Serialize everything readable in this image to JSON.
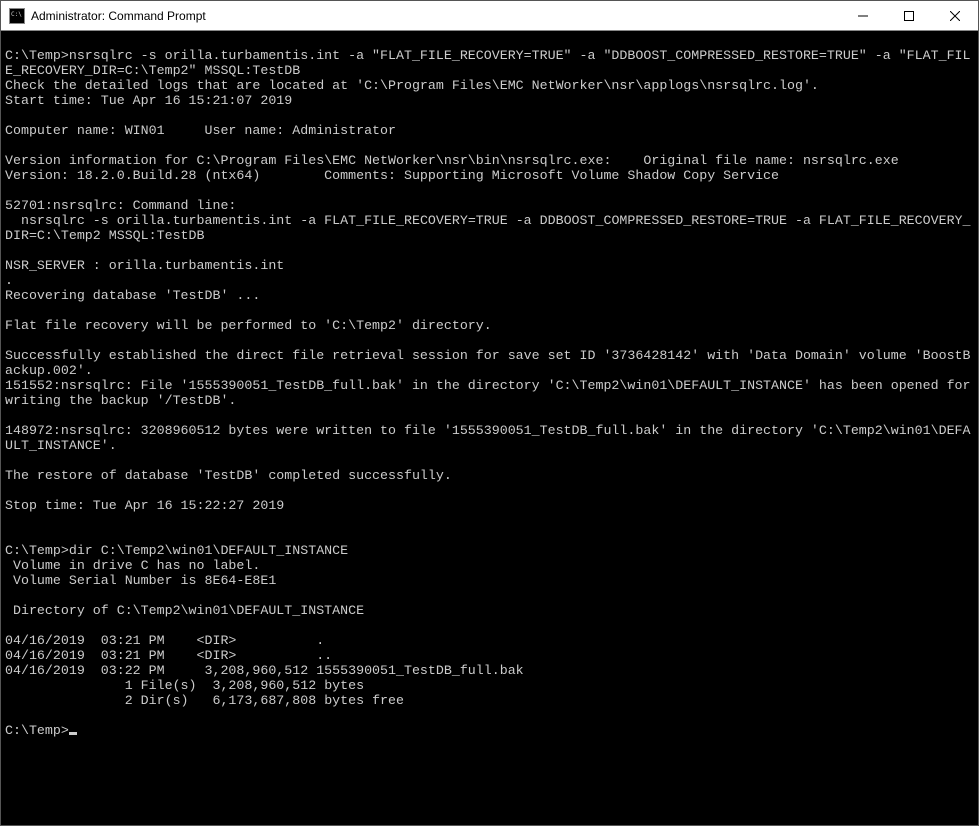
{
  "window": {
    "title": "Administrator: Command Prompt"
  },
  "terminal": {
    "content": "\nC:\\Temp>nsrsqlrc -s orilla.turbamentis.int -a \"FLAT_FILE_RECOVERY=TRUE\" -a \"DDBOOST_COMPRESSED_RESTORE=TRUE\" -a \"FLAT_FILE_RECOVERY_DIR=C:\\Temp2\" MSSQL:TestDB\nCheck the detailed logs that are located at 'C:\\Program Files\\EMC NetWorker\\nsr\\applogs\\nsrsqlrc.log'.\nStart time: Tue Apr 16 15:21:07 2019\n\nComputer name: WIN01     User name: Administrator\n\nVersion information for C:\\Program Files\\EMC NetWorker\\nsr\\bin\\nsrsqlrc.exe:    Original file name: nsrsqlrc.exe\nVersion: 18.2.0.Build.28 (ntx64)        Comments: Supporting Microsoft Volume Shadow Copy Service\n\n52701:nsrsqlrc: Command line:\n  nsrsqlrc -s orilla.turbamentis.int -a FLAT_FILE_RECOVERY=TRUE -a DDBOOST_COMPRESSED_RESTORE=TRUE -a FLAT_FILE_RECOVERY_DIR=C:\\Temp2 MSSQL:TestDB\n\nNSR_SERVER : orilla.turbamentis.int\n.\nRecovering database 'TestDB' ...\n\nFlat file recovery will be performed to 'C:\\Temp2' directory.\n\nSuccessfully established the direct file retrieval session for save set ID '3736428142' with 'Data Domain' volume 'BoostBackup.002'.\n151552:nsrsqlrc: File '1555390051_TestDB_full.bak' in the directory 'C:\\Temp2\\win01\\DEFAULT_INSTANCE' has been opened for writing the backup '/TestDB'.\n\n148972:nsrsqlrc: 3208960512 bytes were written to file '1555390051_TestDB_full.bak' in the directory 'C:\\Temp2\\win01\\DEFAULT_INSTANCE'.\n\nThe restore of database 'TestDB' completed successfully.\n\nStop time: Tue Apr 16 15:22:27 2019\n\n\nC:\\Temp>dir C:\\Temp2\\win01\\DEFAULT_INSTANCE\n Volume in drive C has no label.\n Volume Serial Number is 8E64-E8E1\n\n Directory of C:\\Temp2\\win01\\DEFAULT_INSTANCE\n\n04/16/2019  03:21 PM    <DIR>          .\n04/16/2019  03:21 PM    <DIR>          ..\n04/16/2019  03:22 PM     3,208,960,512 1555390051_TestDB_full.bak\n               1 File(s)  3,208,960,512 bytes\n               2 Dir(s)   6,173,687,808 bytes free\n\nC:\\Temp>"
  }
}
